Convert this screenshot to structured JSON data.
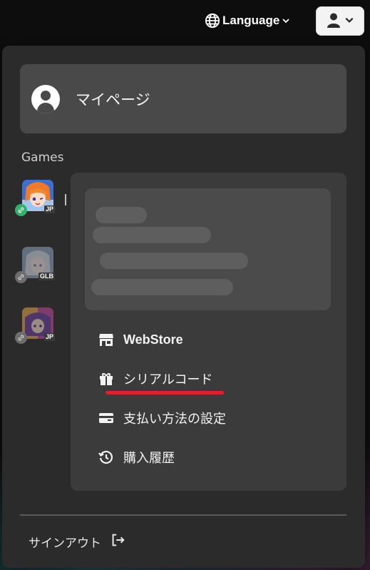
{
  "header": {
    "language_label": "Language",
    "globe_icon": "globe-icon",
    "user_icon": "user-icon"
  },
  "menu": {
    "mypage_label": "マイページ",
    "games_title": "Games",
    "games": [
      {
        "region": "JP",
        "linked": true,
        "status_color": "#2fb36a"
      },
      {
        "region": "GLB",
        "linked": false
      },
      {
        "region": "JP",
        "linked": false
      }
    ],
    "items": [
      {
        "label": "WebStore",
        "icon": "store-icon"
      },
      {
        "label": "シリアルコード",
        "icon": "gift-icon"
      },
      {
        "label": "支払い方法の設定",
        "icon": "card-icon"
      },
      {
        "label": "購入履歴",
        "icon": "history-icon"
      }
    ],
    "signout_label": "サインアウト",
    "signout_icon": "signout-icon"
  },
  "colors": {
    "menu_bg": "#2b2b2c",
    "panel_bg": "#3b3b3c",
    "highlight_underline": "#e0202a",
    "linked_badge": "#2fb36a"
  }
}
